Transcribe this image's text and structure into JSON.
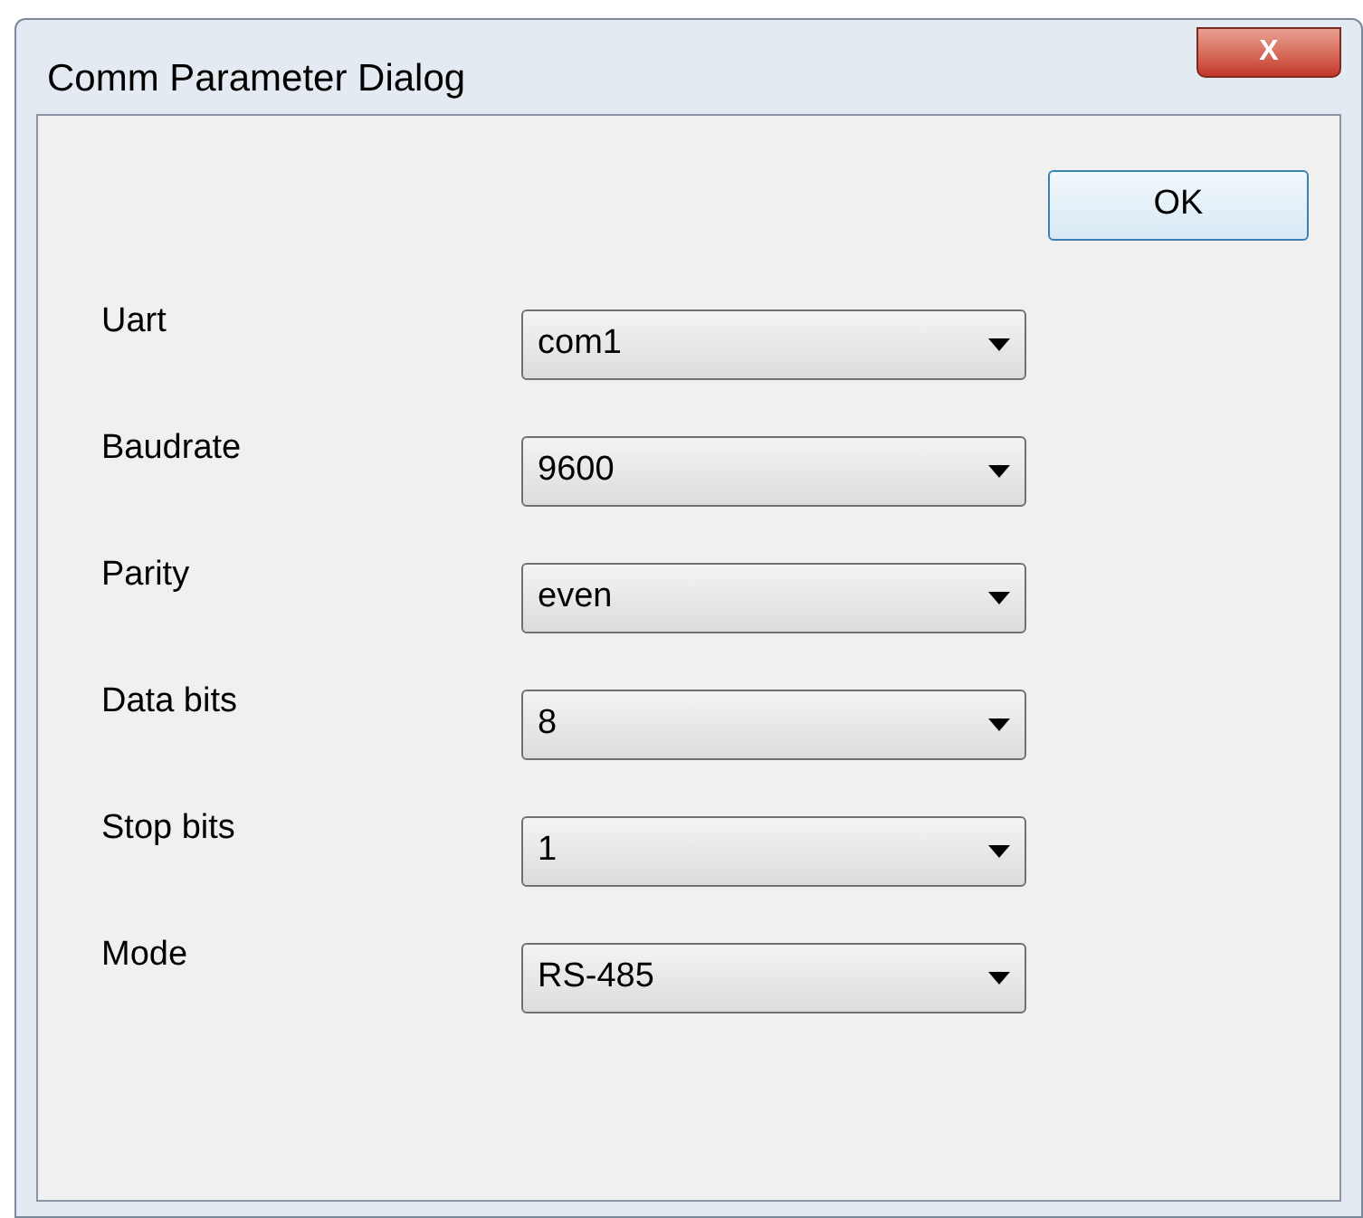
{
  "window": {
    "title": "Comm Parameter Dialog",
    "close_label": "X"
  },
  "ok_button": "OK",
  "fields": [
    {
      "label": "Uart",
      "value": "com1"
    },
    {
      "label": "Baudrate",
      "value": "9600"
    },
    {
      "label": "Parity",
      "value": "even"
    },
    {
      "label": "Data bits",
      "value": "8"
    },
    {
      "label": "Stop bits",
      "value": "1"
    },
    {
      "label": "Mode",
      "value": "RS-485"
    }
  ]
}
